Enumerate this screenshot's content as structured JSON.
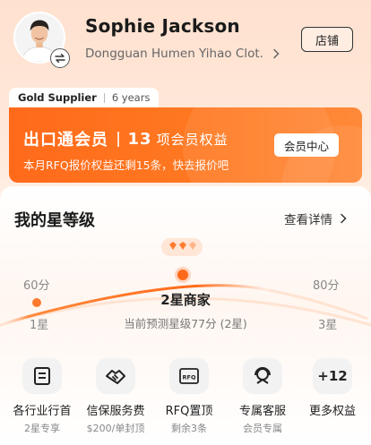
{
  "profile": {
    "name": "Sophie Jackson",
    "company": "Dongguan Humen Yihao Clot.",
    "shop_button": "店铺"
  },
  "supplier": {
    "badge": "Gold Supplier",
    "years": "6 years"
  },
  "membership": {
    "title": "出口通会员",
    "count": "13",
    "rights_label": "项会员权益",
    "subtitle": "本月RFQ报价权益还剩15条，快去报价吧",
    "center_button": "会员中心",
    "card_color": "#FF6A1A"
  },
  "star_level": {
    "title": "我的星等级",
    "details_link": "查看详情",
    "left": {
      "score": "60分",
      "level": "1星"
    },
    "right": {
      "score": "80分",
      "level": "3星"
    },
    "current_name": "2星商家",
    "current_desc": "当前预测星级77分 (2星)",
    "accent_color": "#FF6A1A"
  },
  "benefits": [
    {
      "icon": "document-icon",
      "label": "各行业行首",
      "sub": "2星专享"
    },
    {
      "icon": "handshake-icon",
      "label": "信保服务费",
      "sub": "$200/单封顶"
    },
    {
      "icon": "rfq-icon",
      "label": "RFQ置顶",
      "sub": "剩余3条"
    },
    {
      "icon": "headset-icon",
      "label": "专属客服",
      "sub": "会员专属"
    },
    {
      "icon": "more-icon",
      "label": "更多权益",
      "text": "+12"
    }
  ]
}
